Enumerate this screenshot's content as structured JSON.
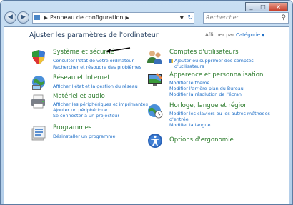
{
  "address": {
    "crumb": "Panneau de configuration",
    "separator": "▶"
  },
  "search": {
    "placeholder": "Rechercher"
  },
  "page": {
    "heading": "Ajuster les paramètres de l'ordinateur",
    "view_by_label": "Afficher par :",
    "view_by_value": "Catégorie"
  },
  "categories_left": [
    {
      "title": "Système et sécurité",
      "icon": "shield-icon",
      "links": [
        "Consulter l'état de votre ordinateur",
        "Rechercher et résoudre des problèmes"
      ]
    },
    {
      "title": "Réseau et Internet",
      "icon": "network-icon",
      "links": [
        "Afficher l'état et la gestion du réseau"
      ]
    },
    {
      "title": "Matériel et audio",
      "icon": "printer-icon",
      "links": [
        "Afficher les périphériques et imprimantes",
        "Ajouter un périphérique",
        "Se connecter à un projecteur"
      ]
    },
    {
      "title": "Programmes",
      "icon": "programs-icon",
      "links": [
        "Désinstaller un programme"
      ]
    }
  ],
  "categories_right": [
    {
      "title": "Comptes d'utilisateurs",
      "icon": "users-icon",
      "links": [
        "Ajouter ou supprimer des comptes",
        "d'utilisateurs"
      ]
    },
    {
      "title": "Apparence et personnalisation",
      "icon": "appearance-icon",
      "links": [
        "Modifier le thème",
        "Modifier l'arrière-plan du Bureau",
        "Modifier la résolution de l'écran"
      ]
    },
    {
      "title": "Horloge, langue et région",
      "icon": "globe-clock-icon",
      "links": [
        "Modifier les claviers ou les autres méthodes",
        "d'entrée",
        "Modifier la langue"
      ]
    },
    {
      "title": "Options d'ergonomie",
      "icon": "accessibility-icon",
      "links": []
    }
  ],
  "colors": {
    "category_title": "#2a7a2a",
    "link": "#1f6fc7",
    "heading": "#1e395b"
  }
}
